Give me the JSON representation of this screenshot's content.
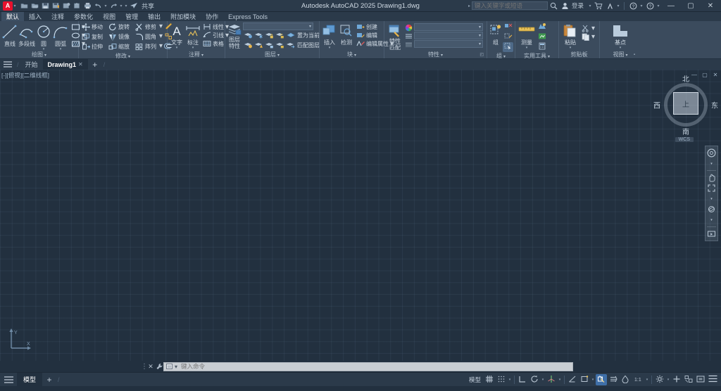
{
  "titlebar": {
    "app_initial": "A",
    "window_title": "Autodesk AutoCAD 2025   Drawing1.dwg",
    "quick_access": [
      {
        "name": "new-file",
        "label": "新建"
      },
      {
        "name": "open-file",
        "label": "打开"
      },
      {
        "name": "save-file",
        "label": "保存"
      },
      {
        "name": "save-as",
        "label": "另存为"
      },
      {
        "name": "cloud-save",
        "label": "保存到 Web"
      },
      {
        "name": "open-from-web",
        "label": "从 Web 打开"
      },
      {
        "name": "plot",
        "label": "打印"
      },
      {
        "name": "undo",
        "label": "放弃"
      },
      {
        "name": "redo",
        "label": "重做"
      },
      {
        "name": "share",
        "label": "共享"
      }
    ],
    "share_label": "共享",
    "search_placeholder": "键入关键字或短语",
    "signin_label": "登录",
    "help_label": "?",
    "minimize": "—",
    "maximize": "▢",
    "close": "✕"
  },
  "ribbon_tabs": [
    {
      "label": "默认",
      "active": true
    },
    {
      "label": "插入",
      "active": false
    },
    {
      "label": "注释",
      "active": false
    },
    {
      "label": "参数化",
      "active": false
    },
    {
      "label": "视图",
      "active": false
    },
    {
      "label": "管理",
      "active": false
    },
    {
      "label": "输出",
      "active": false
    },
    {
      "label": "附加模块",
      "active": false
    },
    {
      "label": "协作",
      "active": false
    },
    {
      "label": "Express Tools",
      "active": false
    }
  ],
  "ribbon_panels": {
    "draw": {
      "title": "绘图",
      "big": [
        {
          "label": "直线",
          "icon": "line-icon"
        },
        {
          "label": "多段线",
          "icon": "polyline-icon"
        },
        {
          "label": "圆",
          "icon": "circle-icon"
        },
        {
          "label": "圆弧",
          "icon": "arc-icon"
        }
      ],
      "small": [
        {
          "label": "矩形",
          "icon": "rectangle-icon"
        },
        {
          "label": "椭圆",
          "icon": "ellipse-icon"
        },
        {
          "label": "图案填充",
          "icon": "hatch-icon"
        }
      ]
    },
    "modify": {
      "title": "修改",
      "items": [
        {
          "label": "移动",
          "icon": "move-icon"
        },
        {
          "label": "旋转",
          "icon": "rotate-icon"
        },
        {
          "label": "修剪",
          "icon": "trim-icon"
        },
        {
          "label": "复制",
          "icon": "copy-icon"
        },
        {
          "label": "镜像",
          "icon": "mirror-icon"
        },
        {
          "label": "圆角",
          "icon": "fillet-icon"
        },
        {
          "label": "拉伸",
          "icon": "stretch-icon"
        },
        {
          "label": "缩放",
          "icon": "scale-icon"
        },
        {
          "label": "阵列",
          "icon": "array-icon"
        }
      ],
      "extra": [
        {
          "label": "",
          "icon": "explode-icon"
        },
        {
          "label": "",
          "icon": "erase-icon"
        },
        {
          "label": "",
          "icon": "offset-icon"
        }
      ]
    },
    "annotation": {
      "title": "注释",
      "big": [
        {
          "label": "文字",
          "icon": "text-icon"
        },
        {
          "label": "标注",
          "icon": "dimension-icon"
        }
      ],
      "small": [
        {
          "label": "线性",
          "icon": "linear-dim-icon"
        },
        {
          "label": "引线",
          "icon": "leader-icon"
        },
        {
          "label": "表格",
          "icon": "table-icon"
        }
      ]
    },
    "layers": {
      "title": "图层",
      "big": [
        {
          "label": "图层\n特性",
          "line1": "图层",
          "line2": "特性",
          "icon": "layer-properties-icon"
        }
      ],
      "dropdown_value": "",
      "row1": [
        {
          "icon": "layer-off-icon"
        },
        {
          "icon": "layer-freeze-icon"
        },
        {
          "icon": "layer-lock-icon"
        },
        {
          "icon": "layer-unlock-icon"
        },
        {
          "icon": "layer-isolate-icon"
        }
      ],
      "row2": [
        {
          "icon": "layer-on-icon"
        },
        {
          "icon": "layer-thaw-icon"
        },
        {
          "icon": "layer-unlock2-icon"
        },
        {
          "icon": "layer-lock2-icon"
        },
        {
          "icon": "layer-merge-icon"
        }
      ],
      "set_current_label": "置为当前",
      "match_layer_label": "匹配图层"
    },
    "block": {
      "title": "块",
      "big": [
        {
          "label": "插入",
          "icon": "insert-block-icon"
        },
        {
          "label": "检测",
          "icon": "inspect-block-icon"
        }
      ],
      "small": [
        {
          "label": "创建",
          "icon": "create-block-icon"
        },
        {
          "label": "编辑",
          "icon": "edit-block-icon"
        },
        {
          "label": "编辑属性",
          "icon": "edit-attribute-icon"
        }
      ]
    },
    "properties": {
      "title": "特性",
      "big": [
        {
          "line1": "特性",
          "line2": "匹配",
          "icon": "properties-icon"
        }
      ],
      "combos": [
        {
          "name": "color-combo",
          "icon": "color-wheel-icon",
          "value": ""
        },
        {
          "name": "linetype-combo",
          "icon": "linetype-icon",
          "value": ""
        },
        {
          "name": "lineweight-combo",
          "icon": "lineweight-icon",
          "value": ""
        }
      ]
    },
    "group": {
      "title": "组",
      "items": [
        {
          "label": "组",
          "icon": "group-icon"
        },
        {
          "icon": "ungroup-icon"
        },
        {
          "icon": "group-edit-icon"
        },
        {
          "icon": "group-select-icon"
        }
      ]
    },
    "utilities": {
      "title": "实用工具",
      "big": [
        {
          "label": "测量",
          "icon": "measure-icon"
        }
      ],
      "small": [
        {
          "icon": "quickcalc-icon"
        },
        {
          "icon": "id-point-icon"
        },
        {
          "icon": "calculator-icon"
        }
      ]
    },
    "clipboard": {
      "title": "剪贴板",
      "big": [
        {
          "label": "粘贴",
          "icon": "paste-icon"
        }
      ],
      "small": [
        {
          "icon": "cut-icon"
        },
        {
          "icon": "copy-clip-icon"
        }
      ]
    },
    "view": {
      "title": "视图",
      "big": [
        {
          "label": "基点",
          "icon": "base-point-icon"
        }
      ]
    }
  },
  "file_tabs": {
    "menu_icon": "hamburger-icon",
    "tabs": [
      {
        "label": "开始",
        "active": false,
        "closable": false
      },
      {
        "label": "Drawing1",
        "active": true,
        "closable": true,
        "close_glyph": "✕"
      }
    ],
    "new_tab_glyph": "+"
  },
  "canvas": {
    "viewport_label": "[-][俯视][二维线框]",
    "viewport_controls": [
      "—",
      "▢",
      "✕"
    ],
    "compass": {
      "north": "北",
      "south": "南",
      "west": "西",
      "east": "东",
      "center": "上"
    },
    "ucs_label": "WCS",
    "navbar_items": [
      {
        "name": "full-navigation-wheel-icon"
      },
      {
        "name": "pan-icon"
      },
      {
        "name": "zoom-extents-icon"
      },
      {
        "name": "orbit-icon"
      },
      {
        "name": "showmotion-icon"
      }
    ]
  },
  "command_line": {
    "close_glyph": "✕",
    "tools_glyph": "⚲",
    "placeholder": "键入命令",
    "value": ""
  },
  "status_bar": {
    "menu_icon": "hamburger-icon",
    "layout_tabs": [
      {
        "label": "模型",
        "active": true
      }
    ],
    "new_layout_glyph": "+",
    "model_label": "模型",
    "right_items": [
      {
        "name": "grid-display-toggle",
        "icon": "grid-icon",
        "on": false
      },
      {
        "name": "snap-mode-toggle",
        "icon": "snap-icon",
        "on": false
      },
      {
        "name": "ortho-mode-toggle",
        "icon": "ortho-icon",
        "on": false
      },
      {
        "name": "polar-tracking-toggle",
        "icon": "polar-icon",
        "on": false
      },
      {
        "name": "isodraft-toggle",
        "icon": "isodraft-icon",
        "on": false
      },
      {
        "name": "object-snap-tracking-toggle",
        "icon": "osnap-tracking-icon",
        "on": false
      },
      {
        "name": "object-snap-toggle",
        "icon": "osnap-icon",
        "on": true
      },
      {
        "name": "lineweight-toggle",
        "icon": "lineweight-display-icon",
        "on": false
      },
      {
        "name": "transparency-toggle",
        "icon": "transparency-icon",
        "on": false
      },
      {
        "name": "annotation-scale",
        "icon": "annotation-scale-icon",
        "on": false
      },
      {
        "name": "workspace-switching",
        "icon": "gear-icon",
        "on": false
      },
      {
        "name": "customization",
        "icon": "plus-icon",
        "on": false
      },
      {
        "name": "isolate-objects",
        "icon": "isolate-icon",
        "on": false
      },
      {
        "name": "clean-screen",
        "icon": "clean-screen-icon",
        "on": false
      },
      {
        "name": "status-menu",
        "icon": "hamburger-icon",
        "on": false
      }
    ]
  }
}
